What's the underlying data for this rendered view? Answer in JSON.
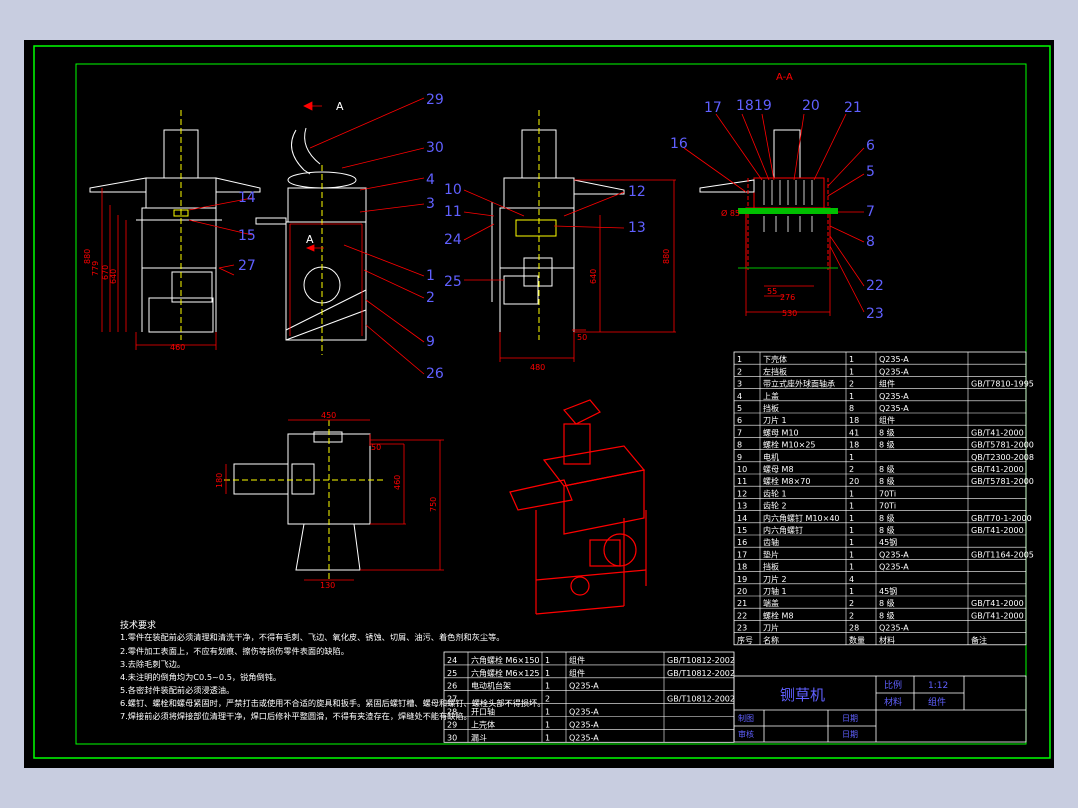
{
  "section_label": "A-A",
  "view_arrow_label": "A",
  "section_cut_label": "A",
  "callouts_front": [
    "29",
    "30",
    "4",
    "3",
    "14",
    "15",
    "27",
    "1",
    "2",
    "9",
    "26"
  ],
  "callouts_side": [
    "10",
    "11",
    "24",
    "12",
    "13",
    "25"
  ],
  "callouts_section": [
    "17",
    "18",
    "19",
    "20",
    "21",
    "16",
    "6",
    "5",
    "7",
    "8",
    "22",
    "23"
  ],
  "dims": {
    "front_height_1": "880",
    "front_height_2": "779",
    "front_height_3": "670",
    "front_height_4": "640",
    "front_width": "460",
    "side_height_1": "880",
    "side_height_2": "640",
    "side_width": "480",
    "side_offset": "50",
    "section_dia": "Ø 85",
    "section_w1": "55",
    "section_w2": "276",
    "section_w3": "530",
    "top_w": "450",
    "top_off": "50",
    "top_h1": "460",
    "top_h2": "750",
    "top_side": "180",
    "top_base": "130"
  },
  "tech_notes": {
    "title": "技术要求",
    "lines": [
      "1.零件在装配前必须清理和清洗干净，不得有毛刺、飞边、氧化皮、锈蚀、切屑、油污、着色剂和灰尘等。",
      "2.零件加工表面上，不应有划痕、擦伤等损伤零件表面的缺陷。",
      "3.去除毛刺飞边。",
      "4.未注明的倒角均为C0.5~0.5，锐角倒钝。",
      "5.各密封件装配前必须浸透油。",
      "6.螺钉、螺栓和螺母紧固时，严禁打击或使用不合适的旋具和扳手。紧固后螺钉槽、螺母和螺钉、螺栓头部不得损坏。",
      "7.焊接前必须将焊接部位清理干净，焊口后修补平整圆滑，不得有夹渣存在，焊缝处不能有缺陷。"
    ]
  },
  "bom_right": [
    {
      "no": "1",
      "name": "下壳体",
      "qty": "1",
      "mat": "Q235-A",
      "std": ""
    },
    {
      "no": "2",
      "name": "左挡板",
      "qty": "1",
      "mat": "Q235-A",
      "std": ""
    },
    {
      "no": "3",
      "name": "带立式座外球面轴承",
      "qty": "2",
      "mat": "组件",
      "std": "GB/T7810-1995"
    },
    {
      "no": "4",
      "name": "上盖",
      "qty": "1",
      "mat": "Q235-A",
      "std": ""
    },
    {
      "no": "5",
      "name": "挡板",
      "qty": "8",
      "mat": "Q235-A",
      "std": ""
    },
    {
      "no": "6",
      "name": "刀片 1",
      "qty": "18",
      "mat": "组件",
      "std": ""
    },
    {
      "no": "7",
      "name": "螺母 M10",
      "qty": "41",
      "mat": "8 级",
      "std": "GB/T41-2000"
    },
    {
      "no": "8",
      "name": "螺栓 M10×25",
      "qty": "18",
      "mat": "8 级",
      "std": "GB/T5781-2000"
    },
    {
      "no": "9",
      "name": "电机",
      "qty": "1",
      "mat": "",
      "std": "QB/T2300-2008"
    },
    {
      "no": "10",
      "name": "螺母 M8",
      "qty": "2",
      "mat": "8 级",
      "std": "GB/T41-2000"
    },
    {
      "no": "11",
      "name": "螺栓 M8×70",
      "qty": "20",
      "mat": "8 级",
      "std": "GB/T5781-2000"
    },
    {
      "no": "12",
      "name": "齿轮 1",
      "qty": "1",
      "mat": "70Ti",
      "std": ""
    },
    {
      "no": "13",
      "name": "齿轮 2",
      "qty": "1",
      "mat": "70Ti",
      "std": ""
    },
    {
      "no": "14",
      "name": "内六角螺钉 M10×40",
      "qty": "1",
      "mat": "8 级",
      "std": "GB/T70-1-2000"
    },
    {
      "no": "15",
      "name": "内六角螺钉",
      "qty": "1",
      "mat": "8 级",
      "std": "GB/T41-2000"
    },
    {
      "no": "16",
      "name": "齿轴",
      "qty": "1",
      "mat": "45钢",
      "std": ""
    },
    {
      "no": "17",
      "name": "垫片",
      "qty": "1",
      "mat": "Q235-A",
      "std": "GB/T1164-2005"
    },
    {
      "no": "18",
      "name": "挡板",
      "qty": "1",
      "mat": "Q235-A",
      "std": ""
    },
    {
      "no": "19",
      "name": "刀片 2",
      "qty": "4",
      "mat": "",
      "std": ""
    },
    {
      "no": "20",
      "name": "刀轴 1",
      "qty": "1",
      "mat": "45钢",
      "std": ""
    },
    {
      "no": "21",
      "name": "端盖",
      "qty": "2",
      "mat": "8 级",
      "std": "GB/T41-2000"
    },
    {
      "no": "22",
      "name": "螺栓 M8",
      "qty": "2",
      "mat": "8 级",
      "std": "GB/T41-2000"
    },
    {
      "no": "23",
      "name": "刀片",
      "qty": "28",
      "mat": "Q235-A",
      "std": ""
    }
  ],
  "bom_header": {
    "no": "序号",
    "name": "名称",
    "qty": "数量",
    "mat": "材料",
    "std": "备注"
  },
  "bom_left": [
    {
      "no": "24",
      "name": "六角螺栓 M6×150",
      "qty": "1",
      "mat": "组件",
      "std": "GB/T10812-2002"
    },
    {
      "no": "25",
      "name": "六角螺栓 M6×125",
      "qty": "1",
      "mat": "组件",
      "std": "GB/T10812-2002"
    },
    {
      "no": "26",
      "name": "电动机台架",
      "qty": "1",
      "mat": "Q235-A",
      "std": ""
    },
    {
      "no": "27",
      "name": "",
      "qty": "2",
      "mat": "",
      "std": "GB/T10812-2002"
    },
    {
      "no": "28",
      "name": "开口轴",
      "qty": "1",
      "mat": "Q235-A",
      "std": ""
    },
    {
      "no": "29",
      "name": "上壳体",
      "qty": "1",
      "mat": "Q235-A",
      "std": ""
    },
    {
      "no": "30",
      "name": "漏斗",
      "qty": "1",
      "mat": "Q235-A",
      "std": ""
    }
  ],
  "title_block": {
    "title": "铡草机",
    "scale_label": "比例",
    "scale_value": "1:12",
    "material_label": "材料",
    "material_value": "组件",
    "drawn_label": "制图",
    "check_label": "审核",
    "date_label_1": "日期",
    "date_label_2": "日期"
  },
  "colors": {
    "background": "#000000",
    "frame": "#00ff00",
    "outline": "#ffffff",
    "dimension": "#ff0000",
    "centerline": "#ffff00",
    "callout_text": "#5050ff",
    "section_fill": "#00c000",
    "page": "#c8cde0"
  }
}
